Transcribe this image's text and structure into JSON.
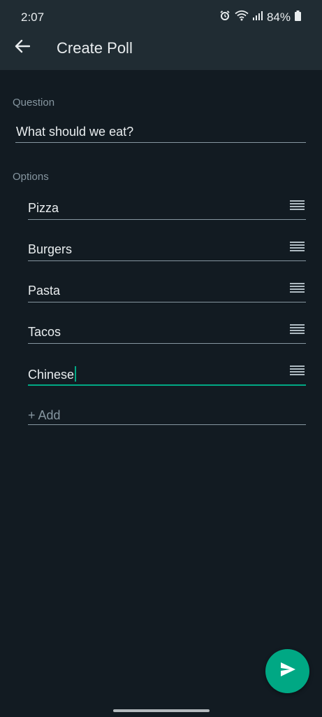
{
  "status_bar": {
    "time": "2:07",
    "battery": "84%"
  },
  "app_bar": {
    "title": "Create Poll",
    "back_icon": "arrow-left-icon"
  },
  "form": {
    "question_label": "Question",
    "question_value": "What should we eat?",
    "options_label": "Options",
    "options": [
      {
        "value": "Pizza"
      },
      {
        "value": "Burgers"
      },
      {
        "value": "Pasta"
      },
      {
        "value": "Tacos"
      },
      {
        "value": "Chinese"
      }
    ],
    "add_placeholder": "+ Add"
  },
  "fab": {
    "icon": "send-icon"
  },
  "colors": {
    "accent": "#00a884",
    "background": "#121b22",
    "header": "#202c33"
  }
}
